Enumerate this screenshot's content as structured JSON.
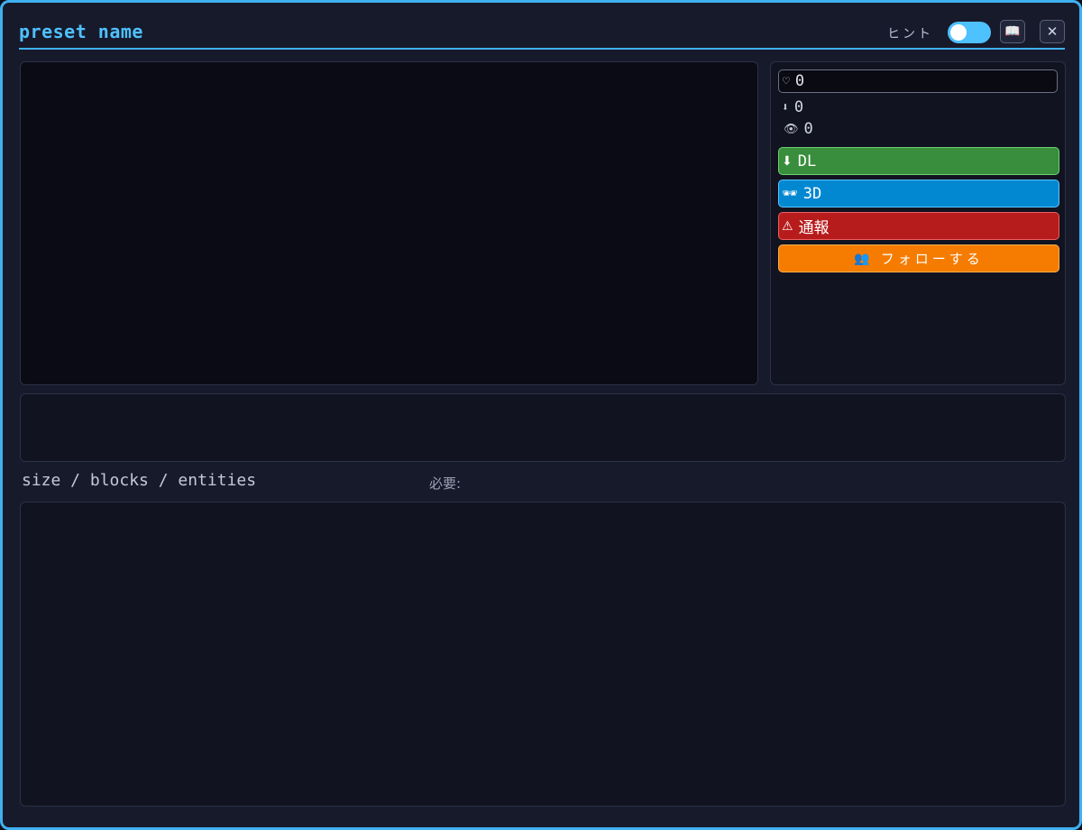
{
  "window": {
    "title": "preset name",
    "hint_label": "ヒント",
    "hint_toggle": "on",
    "guide_icon": "book-icon",
    "close_icon": "close-icon",
    "close_glyph": "✕",
    "guide_glyph": "📖"
  },
  "stats": {
    "likes": {
      "icon": "heart-icon",
      "glyph": "♡",
      "value": "0"
    },
    "downloads": {
      "icon": "download-icon",
      "glyph": "⬇",
      "value": "0"
    },
    "views": {
      "icon": "eye-icon",
      "glyph": "👁",
      "value": "0"
    }
  },
  "actions": {
    "download": {
      "icon": "download-icon",
      "glyph": "⬇",
      "label": "DL",
      "color": "#388e3c"
    },
    "view3d": {
      "icon": "glasses-icon",
      "glyph": "🕶",
      "label": "3D",
      "color": "#0288d1"
    },
    "report": {
      "icon": "warning-icon",
      "glyph": "⚠",
      "label": "通報",
      "color": "#b71c1c"
    },
    "follow": {
      "icon": "users-icon",
      "glyph": "👥",
      "label": "フォローする",
      "color": "#f57c00"
    }
  },
  "meta": {
    "summary": "size / blocks / entities",
    "required_label": "必要:"
  },
  "colors": {
    "accent": "#3fb0f0",
    "background": "#171a2b"
  }
}
